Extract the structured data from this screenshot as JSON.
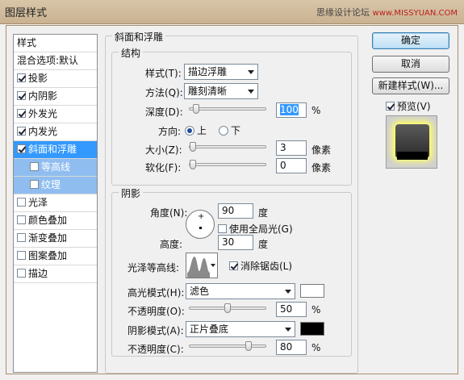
{
  "window": {
    "title": "图层样式",
    "watermark_cn": "思缘设计论坛",
    "watermark_en": "www.MISSYUAN.COM"
  },
  "style_list": {
    "header": "样式",
    "blend": "混合选项:默认",
    "items": [
      {
        "label": "投影",
        "checked": true
      },
      {
        "label": "内阴影",
        "checked": true
      },
      {
        "label": "外发光",
        "checked": true
      },
      {
        "label": "内发光",
        "checked": true
      },
      {
        "label": "斜面和浮雕",
        "checked": true,
        "selected": true
      },
      {
        "label": "等高线",
        "checked": false,
        "sub": true
      },
      {
        "label": "纹理",
        "checked": false,
        "sub": true
      },
      {
        "label": "光泽",
        "checked": false
      },
      {
        "label": "颜色叠加",
        "checked": false
      },
      {
        "label": "渐变叠加",
        "checked": false
      },
      {
        "label": "图案叠加",
        "checked": false
      },
      {
        "label": "描边",
        "checked": false
      }
    ]
  },
  "bevel": {
    "section_title": "斜面和浮雕",
    "structure_title": "结构",
    "style_label": "样式(T):",
    "style_value": "描边浮雕",
    "technique_label": "方法(Q):",
    "technique_value": "雕刻清晰",
    "depth_label": "深度(D):",
    "depth_value": "100",
    "depth_unit": "%",
    "depth_level": 0.05,
    "direction_label": "方向:",
    "dir_up": "上",
    "dir_down": "下",
    "size_label": "大小(Z):",
    "size_value": "3",
    "size_unit": "像素",
    "size_level": 0.0,
    "soften_label": "软化(F):",
    "soften_value": "0",
    "soften_unit": "像素",
    "soften_level": 0.0
  },
  "shading": {
    "title": "阴影",
    "angle_label": "角度(N):",
    "angle_value": "90",
    "angle_unit": "度",
    "global_light_label": "使用全局光(G)",
    "altitude_label": "高度:",
    "altitude_value": "30",
    "altitude_unit": "度",
    "gloss_label": "光泽等高线:",
    "antialias_label": "消除锯齿(L)",
    "highlight_label": "高光模式(H):",
    "highlight_value": "滤色",
    "highlight_color": "#ffffff",
    "opacity1_label": "不透明度(O):",
    "opacity1_value": "50",
    "opacity1_unit": "%",
    "opacity1_level": 0.5,
    "shadow_label": "阴影模式(A):",
    "shadow_value": "正片叠底",
    "shadow_color": "#000000",
    "opacity2_label": "不透明度(C):",
    "opacity2_value": "80",
    "opacity2_unit": "%",
    "opacity2_level": 0.8
  },
  "buttons": {
    "ok": "确定",
    "cancel": "取消",
    "new_style": "新建样式(W)...",
    "preview": "预览(V)"
  }
}
